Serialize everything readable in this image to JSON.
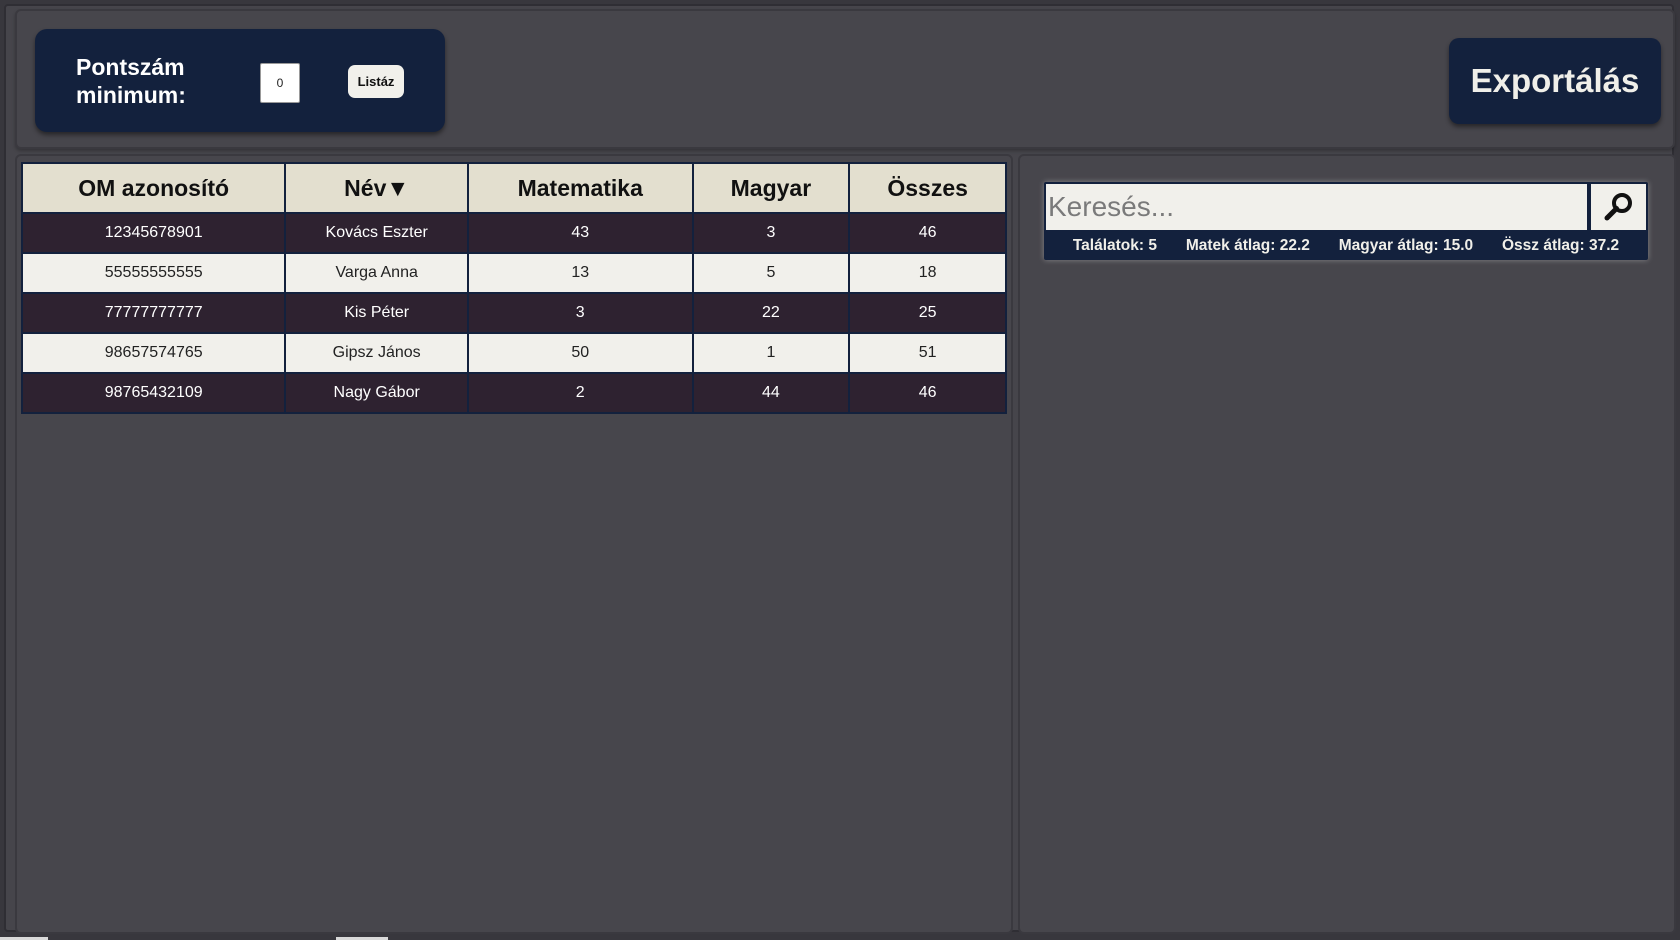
{
  "filter": {
    "label": "Pontszám minimum:",
    "min_value": "0",
    "list_button": "Listáz"
  },
  "export_button": "Exportálás",
  "table": {
    "headers": [
      "OM azonosító",
      "Név▼",
      "Matematika",
      "Magyar",
      "Összes"
    ],
    "rows": [
      {
        "om": "12345678901",
        "name": "Kovács Eszter",
        "math": "43",
        "hun": "3",
        "total": "46"
      },
      {
        "om": "55555555555",
        "name": "Varga Anna",
        "math": "13",
        "hun": "5",
        "total": "18"
      },
      {
        "om": "77777777777",
        "name": "Kis Péter",
        "math": "3",
        "hun": "22",
        "total": "25"
      },
      {
        "om": "98657574765",
        "name": "Gipsz János",
        "math": "50",
        "hun": "1",
        "total": "51"
      },
      {
        "om": "98765432109",
        "name": "Nagy Gábor",
        "math": "2",
        "hun": "44",
        "total": "46"
      }
    ]
  },
  "search": {
    "placeholder": "Keresés...",
    "button_icon": "search-icon"
  },
  "stats": {
    "hits": "Találatok: 5",
    "math_avg": "Matek átlag: 22.2",
    "hun_avg": "Magyar átlag: 15.0",
    "total_avg": "Össz átlag: 37.2"
  },
  "colors": {
    "navy": "#13213d",
    "background": "#46454b",
    "header_cell": "#e3dfcf",
    "dark_row": "#2e2230",
    "light_row": "#f1f0eb"
  }
}
